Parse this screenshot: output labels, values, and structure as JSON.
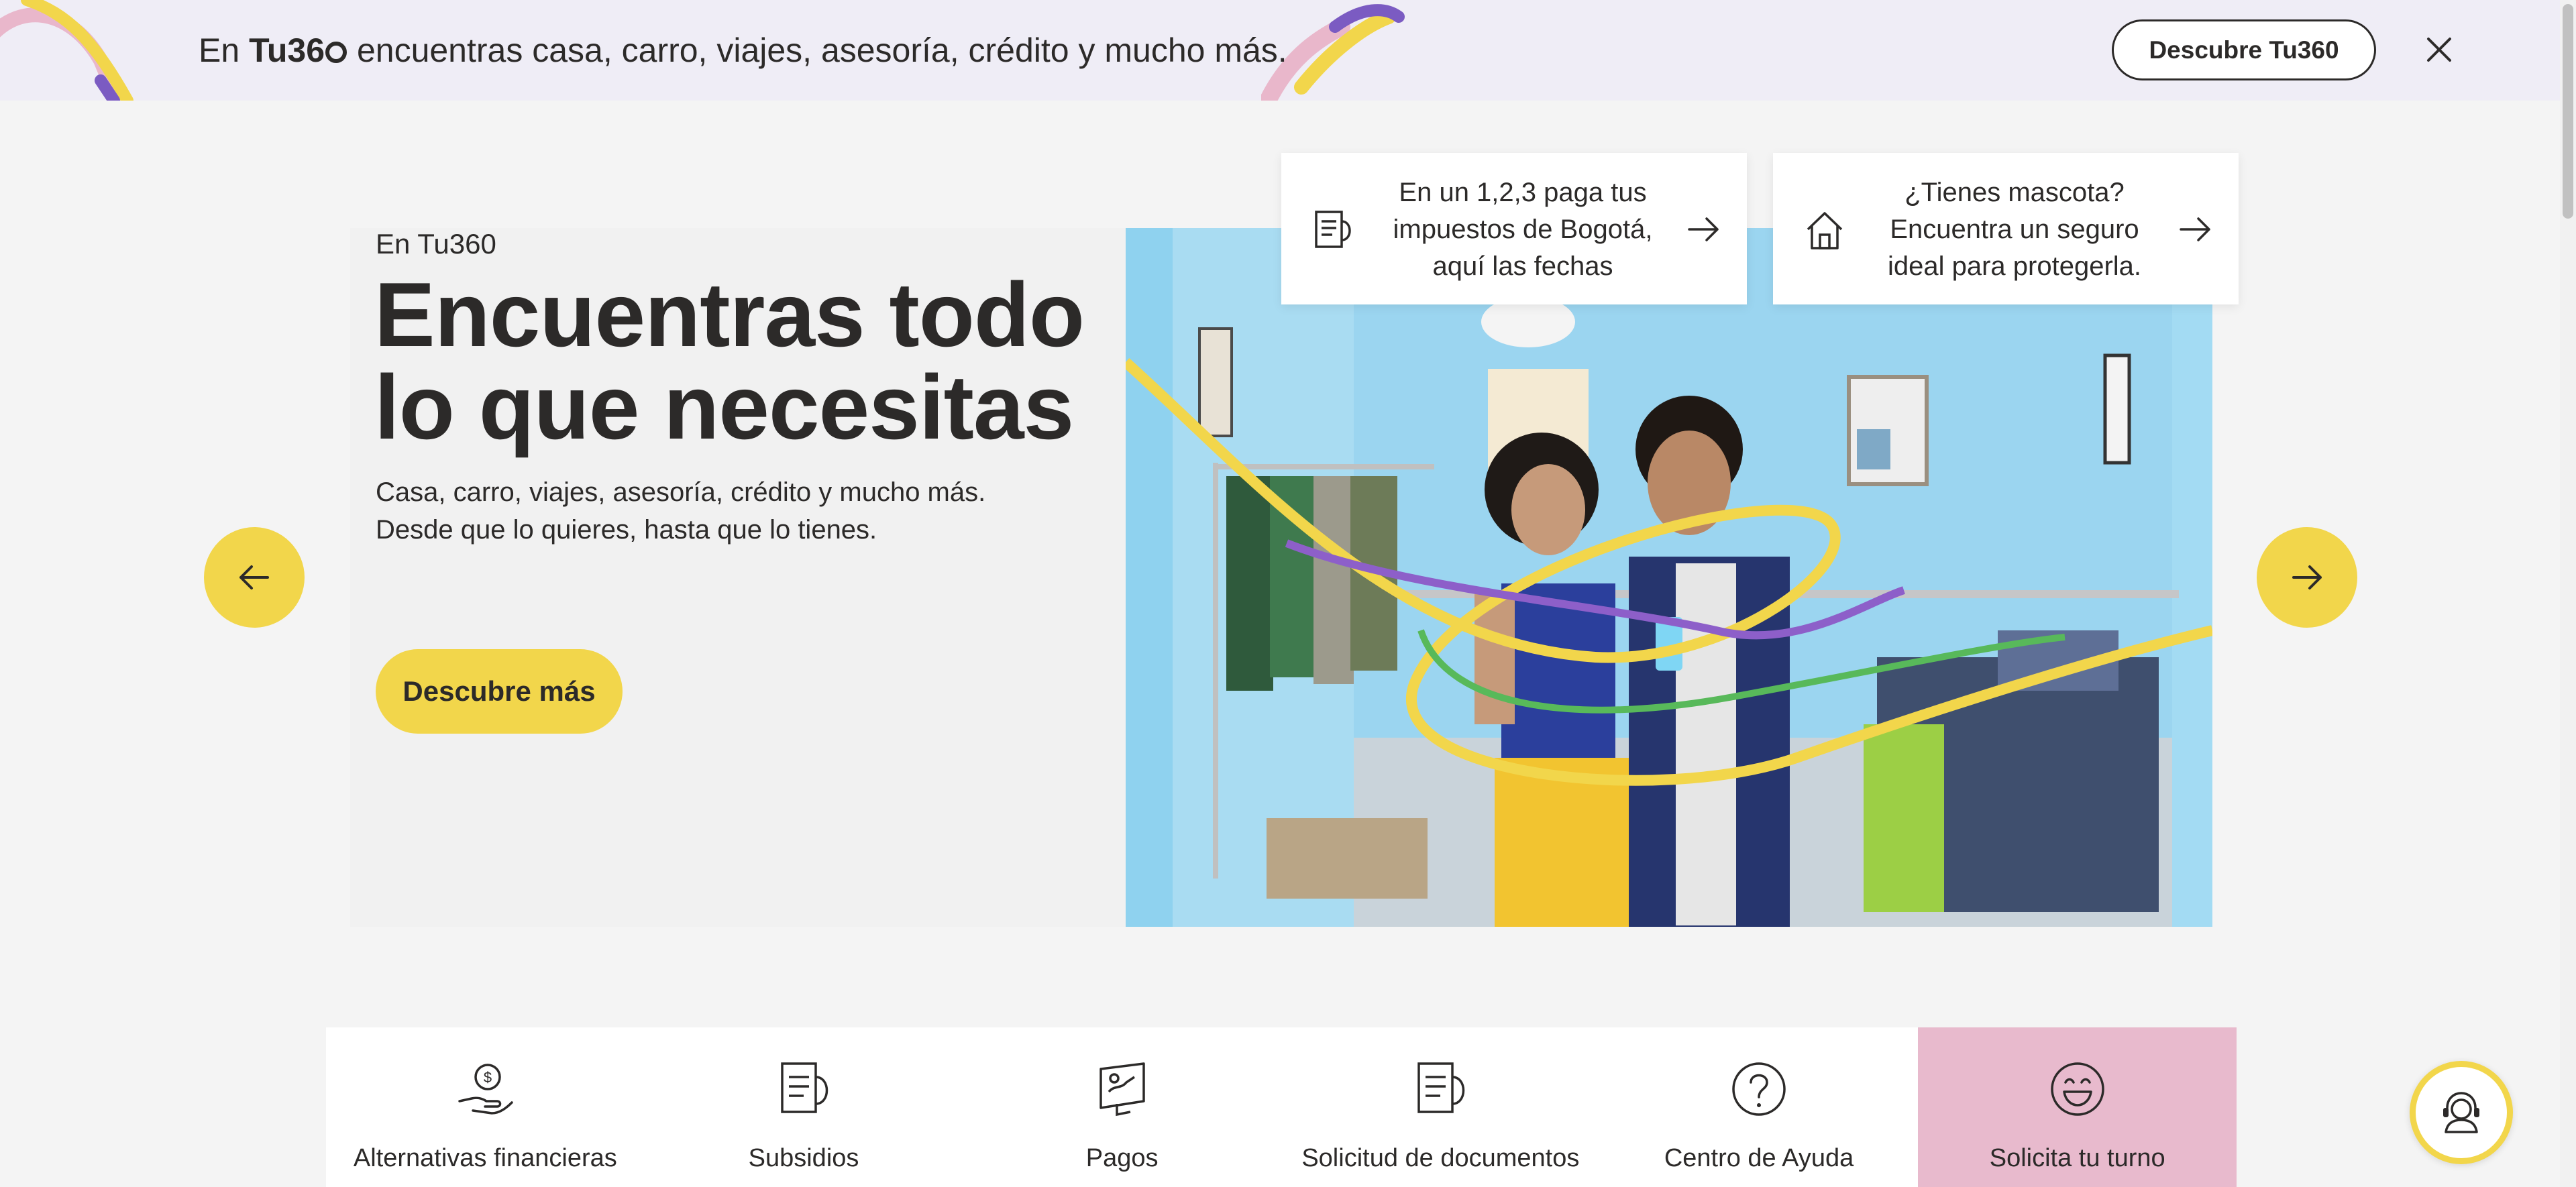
{
  "promo": {
    "text_before": "En ",
    "brand": "Tu36",
    "text_after": " encuentras casa, carro, viajes, asesoría, crédito y mucho más.",
    "button_label": "Descubre Tu360",
    "close_icon": "close-icon"
  },
  "hero": {
    "eyebrow": "En Tu360",
    "title": "Encuentras todo lo que necesitas",
    "description_line1": "Casa, carro, viajes, asesoría, crédito y mucho más.",
    "description_line2": "Desde que lo quieres, hasta que lo tienes.",
    "cta_label": "Descubre más",
    "prev_icon": "arrow-left-icon",
    "next_icon": "arrow-right-icon"
  },
  "cards": [
    {
      "text": "En un 1,2,3 paga tus impuestos de Bogotá, aquí las fechas",
      "icon": "document-icon"
    },
    {
      "text": "¿Tienes mascota? Encuentra un seguro ideal para protegerla.",
      "icon": "house-icon"
    }
  ],
  "quick_access": [
    {
      "label": "Alternativas financieras",
      "icon": "hand-money-icon",
      "active": false
    },
    {
      "label": "Subsidios",
      "icon": "document-icon",
      "active": false
    },
    {
      "label": "Pagos",
      "icon": "wallet-icon",
      "active": false
    },
    {
      "label": "Solicitud de documentos",
      "icon": "document-icon",
      "active": false
    },
    {
      "label": "Centro de Ayuda",
      "icon": "question-icon",
      "active": false
    },
    {
      "label": "Solicita tu turno",
      "icon": "smile-icon",
      "active": true
    }
  ],
  "colors": {
    "accent_yellow": "#f2d64b",
    "banner_bg": "#efedf6",
    "active_tab": "#e8bacd",
    "text": "#2c2a29"
  }
}
